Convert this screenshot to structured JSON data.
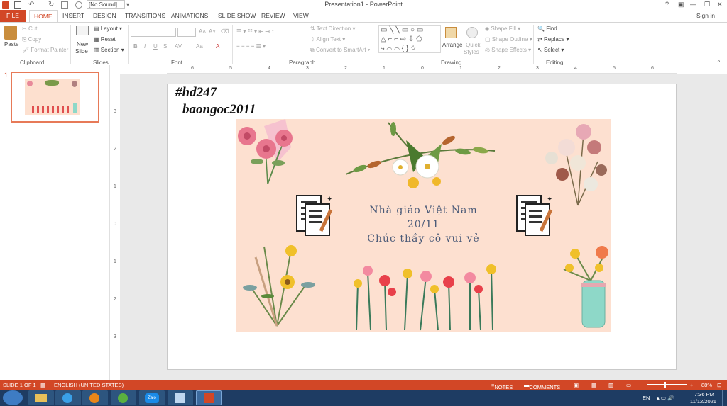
{
  "quick_access": {
    "sound_value": "[No Sound]"
  },
  "window": {
    "title": "Presentation1 - PowerPoint",
    "help": "?",
    "sign_in": "Sign in"
  },
  "tabs": [
    "FILE",
    "HOME",
    "INSERT",
    "DESIGN",
    "TRANSITIONS",
    "ANIMATIONS",
    "SLIDE SHOW",
    "REVIEW",
    "VIEW"
  ],
  "ribbon": {
    "clipboard": {
      "paste": "Paste",
      "cut": "Cut",
      "copy": "Copy",
      "format_painter": "Format Painter",
      "label": "Clipboard"
    },
    "slides": {
      "new_slide": "New",
      "new_slide2": "Slide",
      "layout": "Layout",
      "reset": "Reset",
      "section": "Section",
      "label": "Slides"
    },
    "font": {
      "label": "Font",
      "bold": "B",
      "italic": "I",
      "underline": "U",
      "strike": "S",
      "spacing": "AV",
      "case": "Aa"
    },
    "paragraph": {
      "label": "Paragraph",
      "text_direction": "Text Direction",
      "align_text": "Align Text",
      "smartart": "Convert to SmartArt"
    },
    "drawing": {
      "label": "Drawing",
      "arrange": "Arrange",
      "quick_styles": "Quick",
      "quick_styles2": "Styles",
      "shape_fill": "Shape Fill",
      "shape_outline": "Shape Outline",
      "shape_effects": "Shape Effects"
    },
    "editing": {
      "label": "Editing",
      "find": "Find",
      "replace": "Replace",
      "select": "Select"
    }
  },
  "ruler": {
    "ticks": [
      "6",
      "5",
      "4",
      "3",
      "2",
      "1",
      "0",
      "1",
      "2",
      "3",
      "4",
      "5",
      "6"
    ],
    "vticks": [
      "3",
      "2",
      "1",
      "0",
      "1",
      "2",
      "3"
    ]
  },
  "thumbnail": {
    "number": "1"
  },
  "slide": {
    "hashtag": "#hd247",
    "username": "baongoc2011",
    "line1": "Nhà giáo Việt Nam",
    "line2": "20/11",
    "line3": "Chúc thầy cô vui vẻ"
  },
  "status": {
    "slide": "SLIDE 1 OF 1",
    "language": "ENGLISH (UNITED STATES)",
    "notes": "NOTES",
    "comments": "COMMENTS",
    "zoom": "88%"
  },
  "taskbar": {
    "lang": "EN",
    "time": "7:36 PM",
    "date": "11/12/2021",
    "zalo": "Zalo"
  },
  "colors": {
    "accent": "#d24726",
    "card": "#fde0d0",
    "text": "#4a5a78"
  }
}
